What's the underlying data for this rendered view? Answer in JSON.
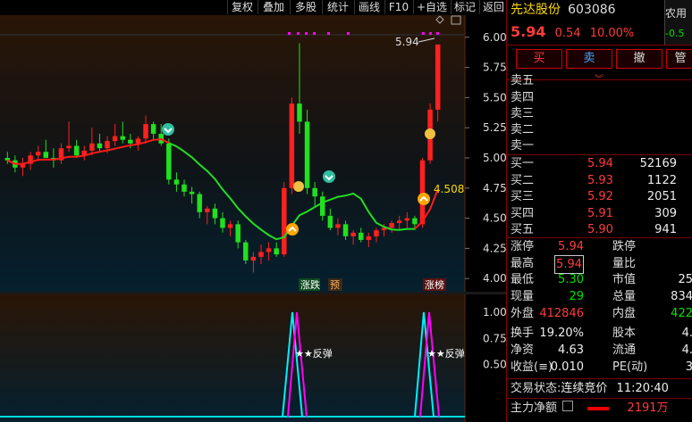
{
  "toolbar": {
    "buttons": [
      {
        "label": "复权"
      },
      {
        "label": "叠加"
      },
      {
        "label": "多股"
      },
      {
        "label": "统计"
      },
      {
        "label": "画线"
      },
      {
        "label": "F10"
      },
      {
        "label": "+自选"
      },
      {
        "label": "标记"
      },
      {
        "label": "返回"
      }
    ]
  },
  "stock": {
    "name": "先达股份",
    "code": "603086",
    "price": "5.94",
    "change": "0.54",
    "change_pct": "10.00%"
  },
  "side_tab": {
    "label": "农用",
    "value": "-0.5"
  },
  "trade_buttons": {
    "buy": "买",
    "sell": "卖",
    "cancel": "撤",
    "more": "管"
  },
  "order_book": {
    "asks": [
      {
        "label": "卖五"
      },
      {
        "label": "卖四"
      },
      {
        "label": "卖三"
      },
      {
        "label": "卖二"
      },
      {
        "label": "卖一"
      }
    ],
    "bids": [
      {
        "label": "买一",
        "price": "5.94",
        "vol": "52169"
      },
      {
        "label": "买二",
        "price": "5.93",
        "vol": "1122"
      },
      {
        "label": "买三",
        "price": "5.92",
        "vol": "2051"
      },
      {
        "label": "买四",
        "price": "5.91",
        "vol": "309"
      },
      {
        "label": "买五",
        "price": "5.90",
        "vol": "941"
      }
    ]
  },
  "stats": {
    "limit_up_label": "涨停",
    "limit_up": "5.94",
    "limit_down_label": "跌停",
    "high_label": "最高",
    "high": "5.94",
    "vol_ratio_label": "量比",
    "low_label": "最低",
    "low": "5.30",
    "mkt_val_label": "市值",
    "mkt_val": "25",
    "cur_label": "现量",
    "cur": "29",
    "total_label": "总量",
    "total": "834",
    "out_label": "外盘",
    "out": "412846",
    "in_label": "内盘",
    "in": "422",
    "turnover_label": "换手",
    "turnover": "19.20%",
    "equity_label": "股本",
    "equity": "4.",
    "nav_label": "净资",
    "nav": "4.63",
    "float_label": "流通",
    "float": "4.",
    "eps_label": "收益(≡)",
    "eps": "0.010",
    "pe_label": "PE(动)",
    "pe": "3"
  },
  "status": {
    "label": "交易状态:",
    "value": "连续竞价",
    "time": "11:20:40"
  },
  "net_flow": {
    "label": "主力净额",
    "value": "2191万"
  },
  "chart_axis": {
    "main_ticks": [
      "6.00",
      "5.75",
      "5.50",
      "5.25",
      "5.00",
      "4.75",
      "4.50",
      "4.25",
      "4.00"
    ],
    "sub_ticks": [
      "1.00",
      "0.75",
      "0.50"
    ]
  },
  "chart_labels": {
    "high_label": "5.94",
    "ma_label": "4.508",
    "tag1": "涨跌",
    "tag2": "预",
    "tag3": "涨榜",
    "sub_mark1": "★★反弹",
    "sub_mark2": "★★反弹"
  },
  "chart_data": {
    "type": "line",
    "candles": [
      [
        5.0,
        5.05,
        4.95,
        4.98
      ],
      [
        4.98,
        5.02,
        4.88,
        4.92
      ],
      [
        4.92,
        5.0,
        4.85,
        4.95
      ],
      [
        4.95,
        5.05,
        4.9,
        5.02
      ],
      [
        5.02,
        5.1,
        4.98,
        5.05
      ],
      [
        5.05,
        5.15,
        5.0,
        5.0
      ],
      [
        5.0,
        5.08,
        4.92,
        4.98
      ],
      [
        4.98,
        5.12,
        4.95,
        5.08
      ],
      [
        5.08,
        5.3,
        5.05,
        5.1
      ],
      [
        5.1,
        5.15,
        5.0,
        5.02
      ],
      [
        5.02,
        5.1,
        4.98,
        5.06
      ],
      [
        5.06,
        5.25,
        5.02,
        5.12
      ],
      [
        5.12,
        5.2,
        5.05,
        5.08
      ],
      [
        5.08,
        5.18,
        5.04,
        5.14
      ],
      [
        5.14,
        5.28,
        5.1,
        5.18
      ],
      [
        5.18,
        5.3,
        5.12,
        5.15
      ],
      [
        5.15,
        5.2,
        5.08,
        5.12
      ],
      [
        5.12,
        5.18,
        5.06,
        5.16
      ],
      [
        5.16,
        5.35,
        5.12,
        5.28
      ],
      [
        5.28,
        5.3,
        5.15,
        5.2
      ],
      [
        5.2,
        5.28,
        5.1,
        5.12
      ],
      [
        5.12,
        5.16,
        4.78,
        4.82
      ],
      [
        4.82,
        4.88,
        4.72,
        4.78
      ],
      [
        4.78,
        4.82,
        4.68,
        4.72
      ],
      [
        4.72,
        4.76,
        4.62,
        4.7
      ],
      [
        4.7,
        4.72,
        4.5,
        4.55
      ],
      [
        4.55,
        4.6,
        4.45,
        4.58
      ],
      [
        4.58,
        4.62,
        4.45,
        4.5
      ],
      [
        4.5,
        4.55,
        4.38,
        4.42
      ],
      [
        4.42,
        4.48,
        4.35,
        4.45
      ],
      [
        4.45,
        4.48,
        4.25,
        4.3
      ],
      [
        4.3,
        4.32,
        4.12,
        4.15
      ],
      [
        4.15,
        4.22,
        4.05,
        4.18
      ],
      [
        4.18,
        4.28,
        4.12,
        4.22
      ],
      [
        4.22,
        4.3,
        4.15,
        4.25
      ],
      [
        4.25,
        4.3,
        4.18,
        4.2
      ],
      [
        4.2,
        4.8,
        4.18,
        4.75
      ],
      [
        4.75,
        5.5,
        4.7,
        5.45
      ],
      [
        5.45,
        5.95,
        5.2,
        5.3
      ],
      [
        5.3,
        5.4,
        4.7,
        4.75
      ],
      [
        4.75,
        4.8,
        4.6,
        4.68
      ],
      [
        4.68,
        4.72,
        4.48,
        4.52
      ],
      [
        4.52,
        4.58,
        4.4,
        4.42
      ],
      [
        4.42,
        4.5,
        4.36,
        4.45
      ],
      [
        4.45,
        4.48,
        4.32,
        4.35
      ],
      [
        4.35,
        4.4,
        4.28,
        4.38
      ],
      [
        4.38,
        4.42,
        4.3,
        4.32
      ],
      [
        4.32,
        4.38,
        4.26,
        4.35
      ],
      [
        4.35,
        4.42,
        4.3,
        4.4
      ],
      [
        4.4,
        4.45,
        4.35,
        4.42
      ],
      [
        4.42,
        4.48,
        4.38,
        4.46
      ],
      [
        4.46,
        4.52,
        4.4,
        4.48
      ],
      [
        4.48,
        4.55,
        4.42,
        4.5
      ],
      [
        4.5,
        4.52,
        4.4,
        4.45
      ],
      [
        4.45,
        5.0,
        4.42,
        4.98
      ],
      [
        4.98,
        5.45,
        4.95,
        5.4
      ],
      [
        5.4,
        5.94,
        5.3,
        5.94
      ]
    ],
    "ma_red": [
      4.8,
      4.82,
      4.85,
      4.88,
      4.9,
      4.92,
      4.94,
      4.96,
      4.98,
      5.0,
      5.01,
      5.02,
      5.03,
      5.04,
      5.05,
      5.06,
      5.07,
      5.08,
      5.09,
      5.1,
      5.1
    ],
    "ylim": [
      3.92,
      6.05
    ]
  }
}
